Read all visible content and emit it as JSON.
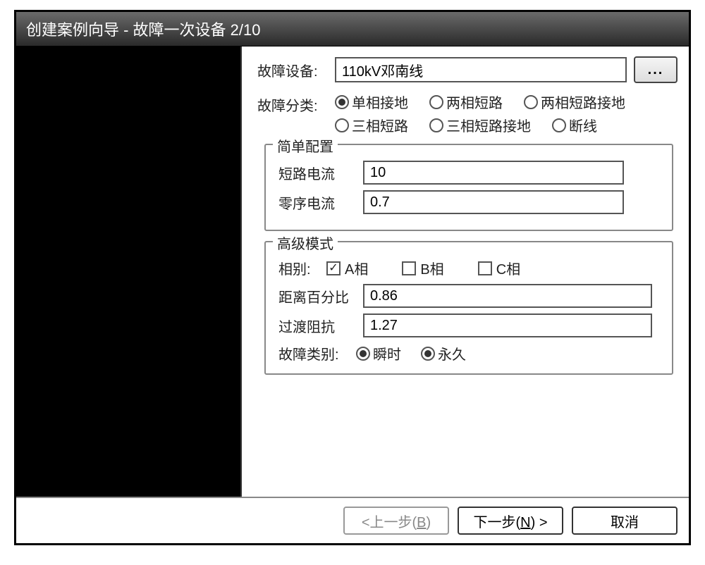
{
  "title": "创建案例向导 - 故障一次设备  2/10",
  "labels": {
    "fault_device": "故障设备:",
    "fault_category": "故障分类:",
    "simple_config": "简单配置",
    "short_circuit_current": "短路电流",
    "zero_seq_current": "零序电流",
    "advanced_mode": "高级模式",
    "phase": "相别:",
    "distance_percent": "距离百分比",
    "transition_impedance": "过渡阻抗",
    "fault_type": "故障类别:"
  },
  "values": {
    "fault_device": "110kV邓南线",
    "short_circuit_current": "10",
    "zero_seq_current": "0.7",
    "distance_percent": "0.86",
    "transition_impedance": "1.27"
  },
  "fault_category_options": {
    "opt1": "单相接地",
    "opt2": "两相短路",
    "opt3": "两相短路接地",
    "opt4": "三相短路",
    "opt5": "三相短路接地",
    "opt6": "断线"
  },
  "fault_category_selected": "opt1",
  "phases": {
    "a": "A相",
    "b": "B相",
    "c": "C相"
  },
  "phases_checked": {
    "a": true,
    "b": false,
    "c": false
  },
  "fault_type_options": {
    "transient": "瞬时",
    "permanent": "永久"
  },
  "fault_type_selected": "transient",
  "buttons": {
    "browse": "...",
    "back_prefix": "<上一步(",
    "back_key": "B",
    "back_suffix": ")",
    "next_prefix": "下一步(",
    "next_key": "N",
    "next_suffix": ") >",
    "cancel": "取消"
  }
}
